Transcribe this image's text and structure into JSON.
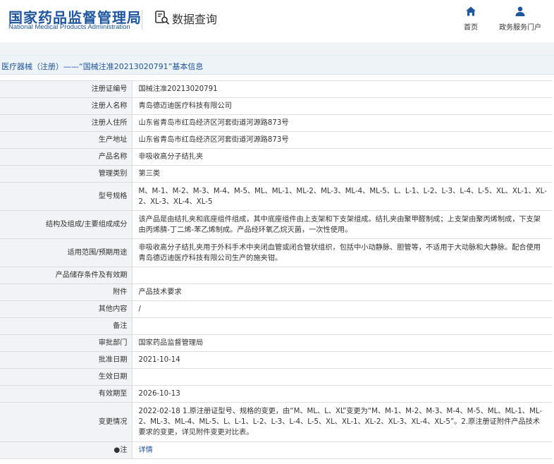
{
  "header": {
    "logo_cn": "国家药品监督管理局",
    "logo_en": "National Medical Products Administration",
    "query_title": "数据查询",
    "nav": [
      {
        "label": "首页",
        "icon": "home-icon"
      },
      {
        "label": "政务服务门户",
        "icon": "user-icon"
      }
    ]
  },
  "breadcrumb": "医疗器械（注册）——“国械注准20213020791”基本信息",
  "colors": {
    "brand": "#1e56a0",
    "label_bg": "#f1f3f6",
    "crumb_bg": "#eef3f8"
  },
  "rows": [
    {
      "label": "注册证编号",
      "value": "国械注准20213020791"
    },
    {
      "label": "注册人名称",
      "value": "青岛德迈迪医疗科技有限公司"
    },
    {
      "label": "注册人住所",
      "value": "山东省青岛市红岛经济区河套街道河源路873号"
    },
    {
      "label": "生产地址",
      "value": "山东省青岛市红岛经济区河套街道河源路873号"
    },
    {
      "label": "产品名称",
      "value": "非吸收高分子结扎夹"
    },
    {
      "label": "管理类别",
      "value": "第三类"
    },
    {
      "label": "型号规格",
      "value": "M、M-1、M-2、M-3、M-4、M-5、ML、ML-1、ML-2、ML-3、ML-4、ML-5、L、L-1、L-2、L-3、L-4、L-5、XL、XL-1、XL-2、XL-3、XL-4、XL-5"
    },
    {
      "label": "结构及组成/主要组成成分",
      "value": "该产品是由结扎夹和底座组件组成，其中底座组件由上支架和下支架组成。结扎夹由聚甲醛制成；上支架由聚丙烯制成，下支架由丙烯腈-丁二烯-苯乙烯制成。产品经环氧乙烷灭菌，一次性使用。"
    },
    {
      "label": "适用范围/预期用途",
      "value": "非吸收高分子结扎夹用于外科手术中夹闭血管或闭合管状组织，包括中小动静脉、胆管等，不适用于大动脉和大静脉。配合使用青岛德迈迪医疗科技有限公司生产的施夹钳。"
    },
    {
      "label": "产品储存条件及有效期",
      "value": ""
    },
    {
      "label": "附件",
      "value": "产品技术要求"
    },
    {
      "label": "其他内容",
      "value": "/"
    },
    {
      "label": "备注",
      "value": ""
    },
    {
      "label": "审批部门",
      "value": "国家药品监督管理局"
    },
    {
      "label": "批准日期",
      "value": "2021-10-14"
    },
    {
      "label": "生效日期",
      "value": ""
    },
    {
      "label": "有效期至",
      "value": "2026-10-13"
    },
    {
      "label": "变更情况",
      "value": "2022-02-18 1.原注册证型号、规格的变更，由“M、ML、L、XL”变更为“M、M-1、M-2、M-3、M-4、M-5、ML、ML-1、ML-2、ML-3、ML-4、ML-5、L、L-1、L-2、L-3、L-4、L-5、XL、XL-1、XL-2、XL-3、XL-4、XL-5”。2.原注册证附件产品技术要求的变更，详见附件变更对比表。"
    },
    {
      "label": "●注",
      "value": "详情"
    }
  ]
}
